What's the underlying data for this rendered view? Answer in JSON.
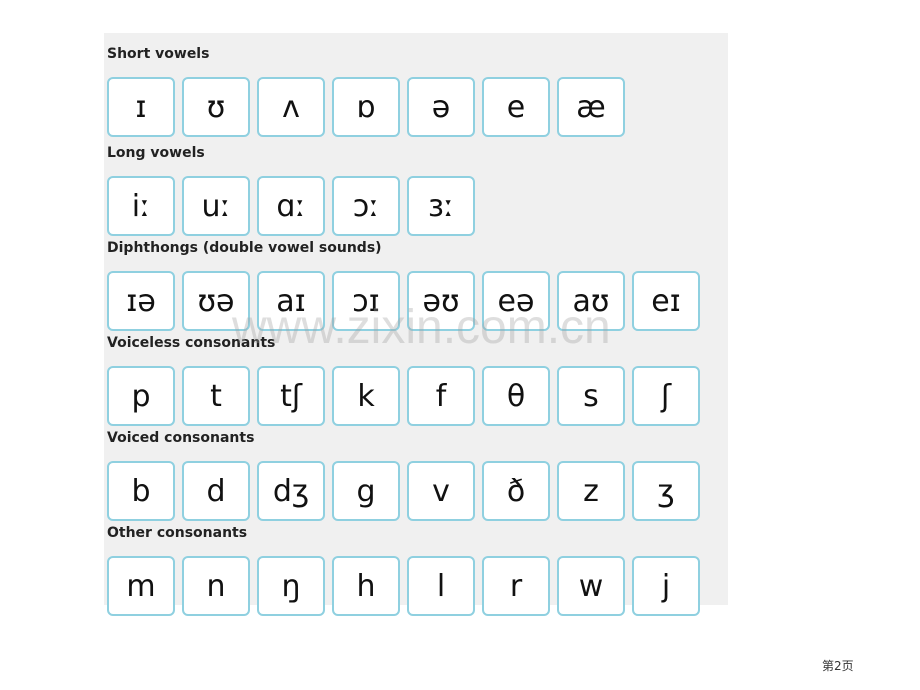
{
  "sections": [
    {
      "label": "Short vowels",
      "symbols": [
        "ɪ",
        "ʊ",
        "ʌ",
        "ɒ",
        "ə",
        "e",
        "æ"
      ]
    },
    {
      "label": "Long vowels",
      "symbols": [
        "iː",
        "uː",
        "ɑː",
        "ɔː",
        "ɜː"
      ]
    },
    {
      "label": "Diphthongs (double vowel sounds)",
      "symbols": [
        "ɪə",
        "ʊə",
        "aɪ",
        "ɔɪ",
        "əʊ",
        "eə",
        "aʊ",
        "eɪ"
      ]
    },
    {
      "label": "Voiceless consonants",
      "symbols": [
        "p",
        "t",
        "tʃ",
        "k",
        "f",
        "θ",
        "s",
        "ʃ"
      ]
    },
    {
      "label": "Voiced consonants",
      "symbols": [
        "b",
        "d",
        "dʒ",
        "g",
        "v",
        "ð",
        "z",
        "ʒ"
      ]
    },
    {
      "label": "Other consonants",
      "symbols": [
        "m",
        "n",
        "ŋ",
        "h",
        "l",
        "r",
        "w",
        "j"
      ]
    }
  ],
  "watermark": "www.zixin.com.cn",
  "page_number": "第2页",
  "colors": {
    "box_border": "#8fd0e0",
    "panel_bg": "#f0f0f0"
  }
}
